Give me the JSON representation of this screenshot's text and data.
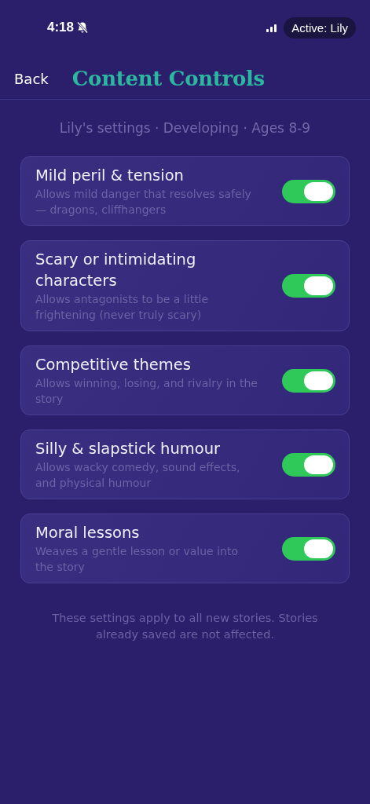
{
  "status_bar": {
    "time": "4:18",
    "silent": true,
    "overlay_label": "Active: Lily"
  },
  "header": {
    "back": "Back",
    "title": "Content Controls"
  },
  "subtitle": "Lily's settings · Developing · Ages 8-9",
  "settings": [
    {
      "title": "Mild peril & tension",
      "description": "Allows mild danger that resolves safely — dragons, cliffhangers",
      "on": true
    },
    {
      "title": "Scary or intimidating characters",
      "description": "Allows antagonists to be a little frightening (never truly scary)",
      "on": true
    },
    {
      "title": "Competitive themes",
      "description": "Allows winning, losing, and rivalry in the story",
      "on": true
    },
    {
      "title": "Silly & slapstick humour",
      "description": "Allows wacky comedy, sound effects, and physical humour",
      "on": true
    },
    {
      "title": "Moral lessons",
      "description": "Weaves a gentle lesson or value into the story",
      "on": true
    }
  ],
  "footnote": "These settings apply to all new stories. Stories already saved are not affected."
}
